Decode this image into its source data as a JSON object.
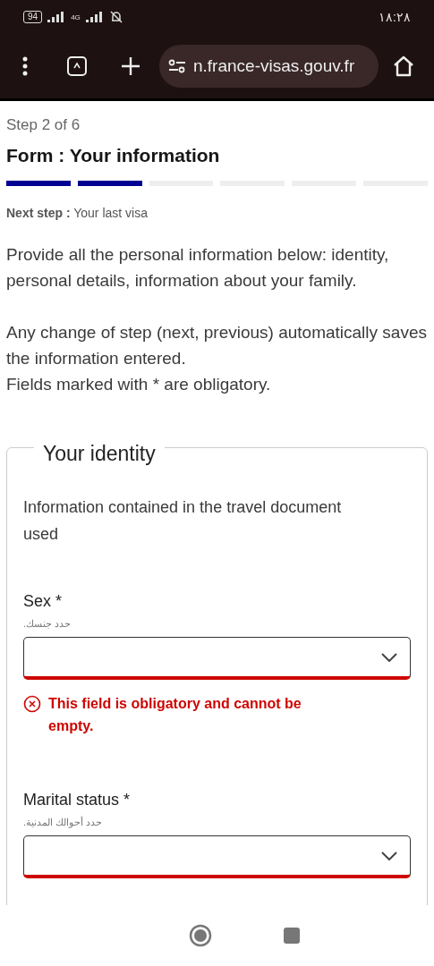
{
  "status_bar": {
    "battery": "94",
    "network": "4G",
    "time": "١٨:٢٨"
  },
  "browser": {
    "url": "n.france-visas.gouv.fr"
  },
  "form": {
    "step": "Step 2 of 6",
    "title": "Form : Your information",
    "steps": [
      {
        "done": true
      },
      {
        "done": true
      },
      {
        "done": false
      },
      {
        "done": false
      },
      {
        "done": false
      },
      {
        "done": false
      }
    ],
    "next_step": "**Next step :** Your last visa",
    "intro": [
      "Provide all the personal information below: identity, personal details, information about your family.",
      "Any change of step (next, previous) automatically saves the information entered.\nFields marked with * are obligatory."
    ],
    "section": {
      "legend": "Your identity",
      "note": "Information contained in the travel document used",
      "fields": [
        {
          "label": "Sex *",
          "hint": "حدد جنسك.",
          "error": "This field is obligatory and cannot be empty."
        },
        {
          "label": "Marital status *",
          "hint": "حدد أحوالك المدنية."
        }
      ]
    }
  }
}
